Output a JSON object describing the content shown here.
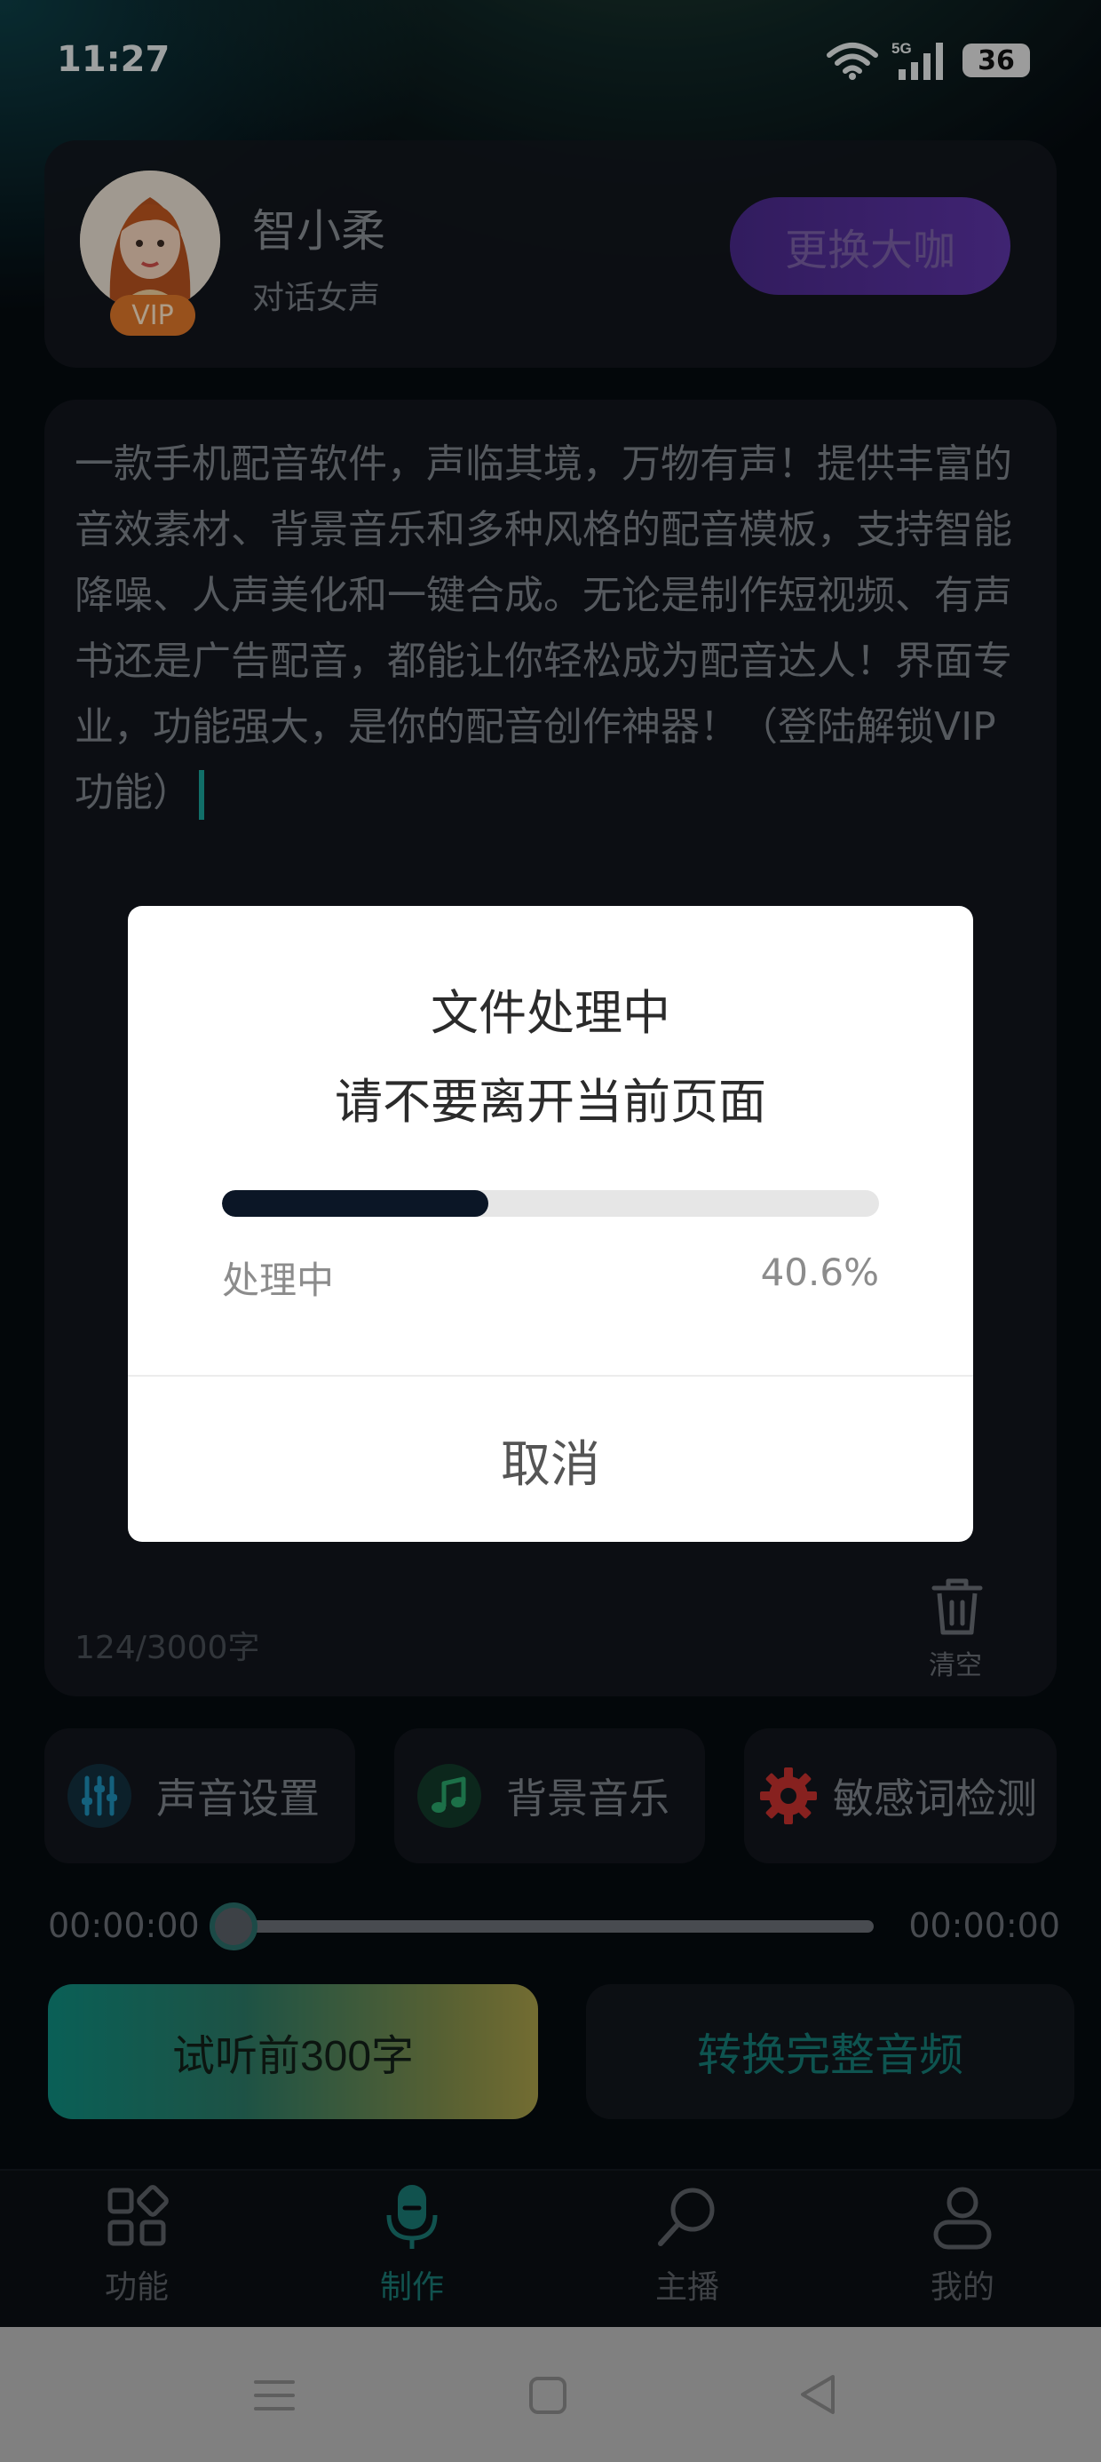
{
  "status_bar": {
    "time": "11:27",
    "network": "5G",
    "battery": "36"
  },
  "voice": {
    "name": "智小柔",
    "subtitle": "对话女声",
    "badge": "VIP",
    "change_label": "更换大咖"
  },
  "editor": {
    "text": "一款手机配音软件，声临其境，万物有声！提供丰富的音效素材、背景音乐和多种风格的配音模板，支持智能降噪、人声美化和一键合成。无论是制作短视频、有声书还是广告配音，都能让你轻松成为配音达人！界面专业，功能强大，是你的配音创作神器！（登陆解锁VIP功能）",
    "counter": "124/3000字",
    "clear_label": "清空"
  },
  "tools": [
    {
      "label": "声音设置",
      "icon": "sliders-icon",
      "color": "#1e8fb8"
    },
    {
      "label": "背景音乐",
      "icon": "music-note-icon",
      "color": "#2aa56a"
    },
    {
      "label": "敏感词检测",
      "icon": "gear-icon",
      "color": "#c8322f"
    }
  ],
  "player": {
    "current": "00:00:00",
    "total": "00:00:00",
    "position": 0
  },
  "actions": {
    "trial_label": "试听前300字",
    "convert_label": "转换完整音频"
  },
  "tabs": [
    {
      "label": "功能",
      "icon": "grid-icon",
      "active": false
    },
    {
      "label": "制作",
      "icon": "microphone-icon",
      "active": true
    },
    {
      "label": "主播",
      "icon": "search-icon",
      "active": false
    },
    {
      "label": "我的",
      "icon": "user-icon",
      "active": false
    }
  ],
  "dialog": {
    "title": "文件处理中",
    "subtitle": "请不要离开当前页面",
    "progress_label": "处理中",
    "progress_percent": "40.6%",
    "progress_value": 0.406,
    "cancel_label": "取消"
  },
  "system_nav": {
    "icons": [
      "menu-icon",
      "home-square-icon",
      "back-triangle-icon"
    ]
  }
}
